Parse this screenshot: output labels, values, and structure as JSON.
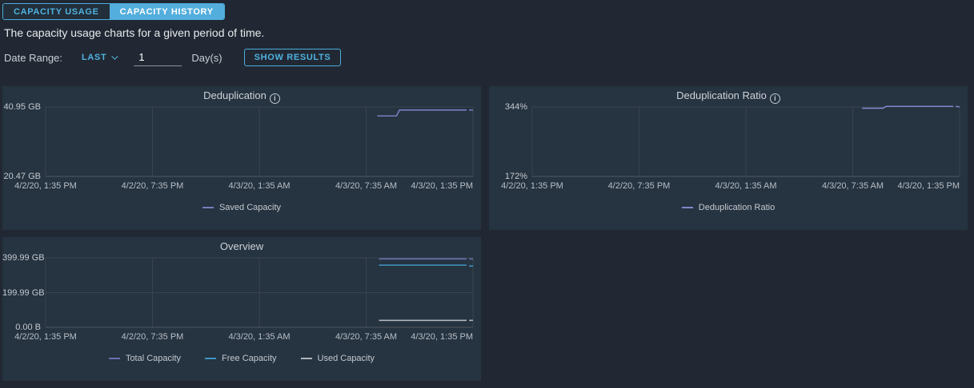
{
  "tabs": [
    {
      "label": "CAPACITY USAGE",
      "active": false
    },
    {
      "label": "CAPACITY HISTORY",
      "active": true
    }
  ],
  "description": "The capacity usage charts for a given period of time.",
  "filter": {
    "date_range_label": "Date Range:",
    "last_dropdown_label": "LAST",
    "days_value": "1",
    "days_unit_label": "Day(s)",
    "show_results_label": "SHOW RESULTS"
  },
  "icons": {
    "info": "i"
  },
  "colors": {
    "page_bg": "#212833",
    "panel_bg": "#263340",
    "accent_blue": "#4fb2e0",
    "grid_line": "#39434e",
    "axis_line": "#4d5863",
    "saved_capacity": "#777cc0",
    "deduplication_ratio": "#7e88c9",
    "total_capacity": "#6a70b2",
    "free_capacity": "#3f95c4",
    "used_capacity": "#aeb5bb"
  },
  "chart_data": [
    {
      "type": "line",
      "title": "Deduplication",
      "info_icon": true,
      "ymin": 20.47,
      "ymax": 40.95,
      "y_axis_labels": [
        {
          "text": "40.95 GB",
          "frac": 0
        },
        {
          "text": "20.47 GB",
          "frac": 1
        }
      ],
      "x_tick_labels": [
        "4/2/20, 1:35 PM",
        "4/2/20, 7:35 PM",
        "4/3/20, 1:35 AM",
        "4/3/20, 7:35 AM",
        "4/3/20, 1:35 PM"
      ],
      "grid": {
        "v": [
          0,
          0.25,
          0.5,
          0.75,
          1
        ],
        "h": [
          0
        ]
      },
      "series": [
        {
          "name": "Saved Capacity",
          "color": "#777cc0",
          "points": [
            [
              0.776,
              38.3
            ],
            [
              0.821,
              38.3
            ],
            [
              0.828,
              40.05
            ],
            [
              0.985,
              40.05
            ]
          ],
          "end_dash": [
            [
              0.991,
              40.05
            ],
            [
              1,
              40.05
            ]
          ]
        }
      ]
    },
    {
      "type": "line",
      "title": "Deduplication Ratio",
      "info_icon": true,
      "ymin": 172,
      "ymax": 344,
      "y_axis_labels": [
        {
          "text": "344%",
          "frac": 0
        },
        {
          "text": "172%",
          "frac": 1
        }
      ],
      "x_tick_labels": [
        "4/2/20, 1:35 PM",
        "4/2/20, 7:35 PM",
        "4/3/20, 1:35 AM",
        "4/3/20, 7:35 AM",
        "4/3/20, 1:35 PM"
      ],
      "grid": {
        "v": [
          0,
          0.25,
          0.5,
          0.75,
          1
        ],
        "h": [
          0
        ]
      },
      "series": [
        {
          "name": "Deduplication Ratio",
          "color": "#7e88c9",
          "points": [
            [
              0.772,
              341
            ],
            [
              0.821,
              341
            ],
            [
              0.828,
              345.5
            ],
            [
              0.985,
              345.5
            ]
          ],
          "end_dash": [
            [
              0.991,
              345.5
            ],
            [
              1,
              344.5
            ]
          ]
        }
      ]
    },
    {
      "type": "line",
      "title": "Overview",
      "info_icon": false,
      "ymin": 0,
      "ymax": 399.99,
      "y_axis_labels": [
        {
          "text": "399.99 GB",
          "frac": 0
        },
        {
          "text": "199.99 GB",
          "frac": 0.5
        },
        {
          "text": "0.00 B",
          "frac": 1
        }
      ],
      "x_tick_labels": [
        "4/2/20, 1:35 PM",
        "4/2/20, 7:35 PM",
        "4/3/20, 1:35 AM",
        "4/3/20, 7:35 AM",
        "4/3/20, 1:35 PM"
      ],
      "grid": {
        "v": [
          0,
          0.25,
          0.5,
          0.75,
          1
        ],
        "h": [
          0,
          0.5
        ]
      },
      "series": [
        {
          "name": "Total Capacity",
          "color": "#6a70b2",
          "points": [
            [
              0.78,
              394
            ],
            [
              0.985,
              394
            ]
          ],
          "end_dash": [
            [
              0.991,
              394
            ],
            [
              1,
              394
            ]
          ]
        },
        {
          "name": "Free Capacity",
          "color": "#3f95c4",
          "points": [
            [
              0.78,
              358
            ],
            [
              0.985,
              358
            ]
          ],
          "end_dash": [
            [
              0.991,
              353
            ],
            [
              1,
              353
            ]
          ]
        },
        {
          "name": "Used Capacity",
          "color": "#aeb5bb",
          "points": [
            [
              0.78,
              40
            ],
            [
              0.985,
              40
            ]
          ],
          "end_dash": [
            [
              0.991,
              40
            ],
            [
              1,
              40
            ]
          ]
        }
      ]
    }
  ]
}
